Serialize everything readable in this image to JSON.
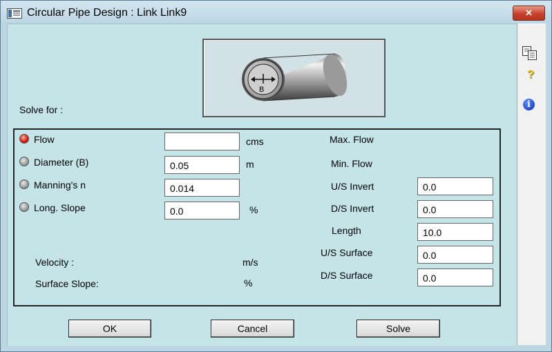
{
  "window": {
    "title": "Circular Pipe Design : Link Link9",
    "close_glyph": "✕"
  },
  "sidebar": {
    "icons": [
      "copy-icon",
      "help-icon",
      "info-icon"
    ],
    "help_glyph": "?",
    "info_glyph": "i"
  },
  "diagram": {
    "label": "B"
  },
  "solve_for": {
    "label": "Solve for :"
  },
  "parameters": [
    {
      "label": "Flow",
      "value": "",
      "unit": "cms",
      "selected": true
    },
    {
      "label": "Diameter  (B)",
      "value": "0.05",
      "unit": "m",
      "selected": false
    },
    {
      "label": "Manning's n",
      "value": "0.014",
      "unit": "",
      "selected": false
    },
    {
      "label": "Long. Slope",
      "value": "0.0",
      "unit": "%",
      "selected": false
    }
  ],
  "results": [
    {
      "label": "Velocity :",
      "unit": "m/s"
    },
    {
      "label": "Surface Slope:",
      "unit": "%"
    }
  ],
  "limits": {
    "max_flow": "Max. Flow",
    "min_flow": "Min. Flow"
  },
  "geometry": [
    {
      "label": "U/S Invert",
      "value": "0.0"
    },
    {
      "label": "D/S Invert",
      "value": "0.0"
    },
    {
      "label": "Length",
      "value": "10.0"
    },
    {
      "label": "U/S Surface",
      "value": "0.0"
    },
    {
      "label": "D/S Surface",
      "value": "0.0"
    }
  ],
  "buttons": {
    "ok": "OK",
    "cancel": "Cancel",
    "solve": "Solve"
  },
  "colors": {
    "background": "#c5e4e8",
    "selected_radio": "#e02010",
    "close_button": "#c8412c"
  }
}
